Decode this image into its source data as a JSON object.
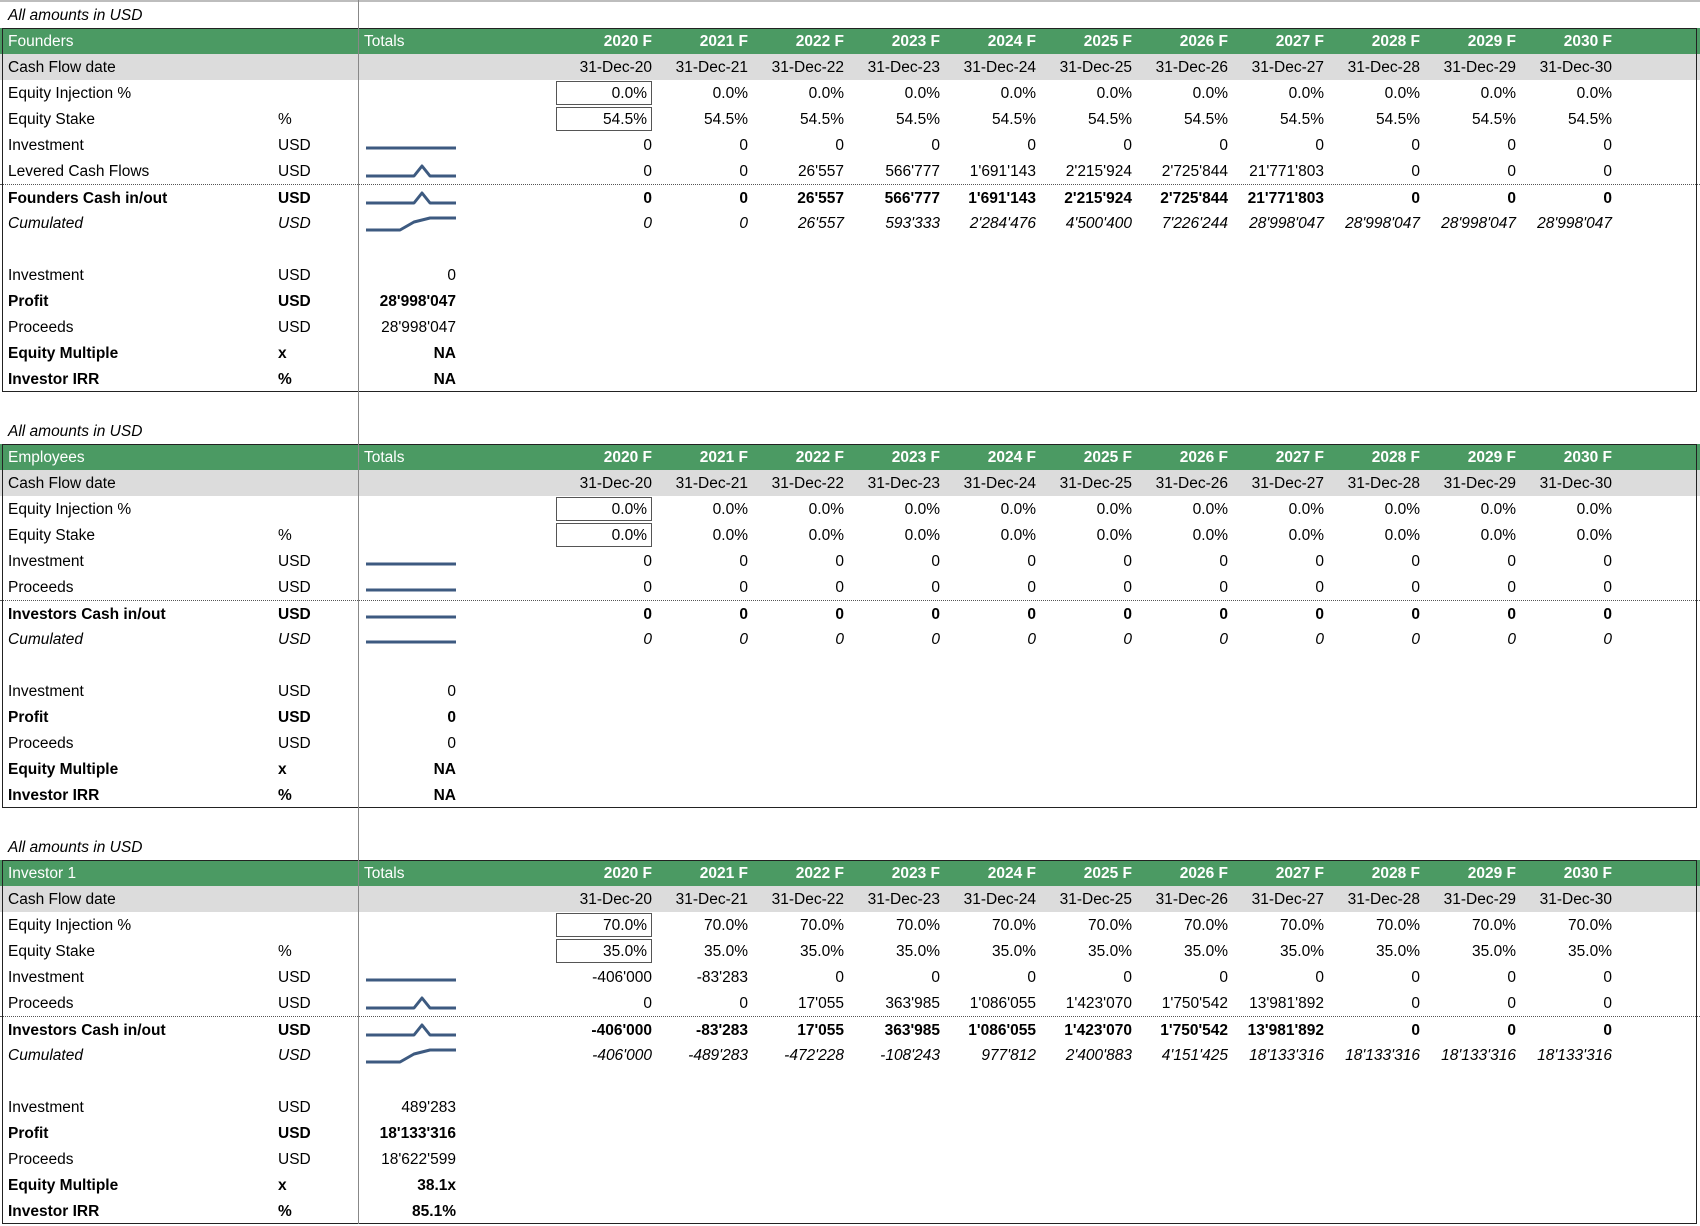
{
  "header_cols": [
    "2020 F",
    "2021 F",
    "2022 F",
    "2023 F",
    "2024 F",
    "2025 F",
    "2026 F",
    "2027 F",
    "2028 F",
    "2029 F",
    "2030 F"
  ],
  "dates": [
    "31-Dec-20",
    "31-Dec-21",
    "31-Dec-22",
    "31-Dec-23",
    "31-Dec-24",
    "31-Dec-25",
    "31-Dec-26",
    "31-Dec-27",
    "31-Dec-28",
    "31-Dec-29",
    "31-Dec-30"
  ],
  "labels": {
    "all_amounts": "All amounts in USD",
    "totals": "Totals",
    "cash_flow_date": "Cash Flow date"
  },
  "sections": [
    {
      "title": "Founders",
      "rows": [
        {
          "label": "Equity Injection %",
          "unit": "",
          "style": "plain",
          "boxed": true,
          "values": [
            "0.0%",
            "0.0%",
            "0.0%",
            "0.0%",
            "0.0%",
            "0.0%",
            "0.0%",
            "0.0%",
            "0.0%",
            "0.0%",
            "0.0%"
          ]
        },
        {
          "label": "Equity Stake",
          "unit": "%",
          "style": "plain",
          "boxed": true,
          "values": [
            "54.5%",
            "54.5%",
            "54.5%",
            "54.5%",
            "54.5%",
            "54.5%",
            "54.5%",
            "54.5%",
            "54.5%",
            "54.5%",
            "54.5%"
          ]
        },
        {
          "label": "Investment",
          "unit": "USD",
          "style": "plain",
          "spark": "flat",
          "values": [
            "0",
            "0",
            "0",
            "0",
            "0",
            "0",
            "0",
            "0",
            "0",
            "0",
            "0"
          ]
        },
        {
          "label": "Levered Cash Flows",
          "unit": "USD",
          "style": "plain",
          "spark": "peak",
          "values": [
            "0",
            "0",
            "26'557",
            "566'777",
            "1'691'143",
            "2'215'924",
            "2'725'844",
            "21'771'803",
            "0",
            "0",
            "0"
          ]
        },
        {
          "label": "Founders Cash in/out",
          "unit": "USD",
          "style": "bold",
          "sep": true,
          "spark": "peak",
          "values": [
            "0",
            "0",
            "26'557",
            "566'777",
            "1'691'143",
            "2'215'924",
            "2'725'844",
            "21'771'803",
            "0",
            "0",
            "0"
          ]
        },
        {
          "label": "Cumulated",
          "unit": "USD",
          "style": "italic",
          "spark": "step",
          "values": [
            "0",
            "0",
            "26'557",
            "593'333",
            "2'284'476",
            "4'500'400",
            "7'226'244",
            "28'998'047",
            "28'998'047",
            "28'998'047",
            "28'998'047"
          ]
        }
      ],
      "summary": [
        {
          "label": "Investment",
          "unit": "USD",
          "value": "0",
          "bold": false
        },
        {
          "label": "Profit",
          "unit": "USD",
          "value": "28'998'047",
          "bold": true
        },
        {
          "label": "Proceeds",
          "unit": "USD",
          "value": "28'998'047",
          "bold": false
        },
        {
          "label": "Equity Multiple",
          "unit": "x",
          "value": "NA",
          "bold": true
        },
        {
          "label": "Investor IRR",
          "unit": "%",
          "value": "NA",
          "bold": true
        }
      ]
    },
    {
      "title": "Employees",
      "rows": [
        {
          "label": "Equity Injection %",
          "unit": "",
          "style": "plain",
          "boxed": true,
          "values": [
            "0.0%",
            "0.0%",
            "0.0%",
            "0.0%",
            "0.0%",
            "0.0%",
            "0.0%",
            "0.0%",
            "0.0%",
            "0.0%",
            "0.0%"
          ]
        },
        {
          "label": "Equity Stake",
          "unit": "%",
          "style": "plain",
          "boxed": true,
          "values": [
            "0.0%",
            "0.0%",
            "0.0%",
            "0.0%",
            "0.0%",
            "0.0%",
            "0.0%",
            "0.0%",
            "0.0%",
            "0.0%",
            "0.0%"
          ]
        },
        {
          "label": "Investment",
          "unit": "USD",
          "style": "plain",
          "spark": "flat",
          "values": [
            "0",
            "0",
            "0",
            "0",
            "0",
            "0",
            "0",
            "0",
            "0",
            "0",
            "0"
          ]
        },
        {
          "label": "Proceeds",
          "unit": "USD",
          "style": "plain",
          "spark": "flat",
          "values": [
            "0",
            "0",
            "0",
            "0",
            "0",
            "0",
            "0",
            "0",
            "0",
            "0",
            "0"
          ]
        },
        {
          "label": "Investors Cash in/out",
          "unit": "USD",
          "style": "bold",
          "sep": true,
          "spark": "flat",
          "values": [
            "0",
            "0",
            "0",
            "0",
            "0",
            "0",
            "0",
            "0",
            "0",
            "0",
            "0"
          ]
        },
        {
          "label": "Cumulated",
          "unit": "USD",
          "style": "italic",
          "spark": "flat",
          "values": [
            "0",
            "0",
            "0",
            "0",
            "0",
            "0",
            "0",
            "0",
            "0",
            "0",
            "0"
          ]
        }
      ],
      "summary": [
        {
          "label": "Investment",
          "unit": "USD",
          "value": "0",
          "bold": false
        },
        {
          "label": "Profit",
          "unit": "USD",
          "value": "0",
          "bold": true
        },
        {
          "label": "Proceeds",
          "unit": "USD",
          "value": "0",
          "bold": false
        },
        {
          "label": "Equity Multiple",
          "unit": "x",
          "value": "NA",
          "bold": true
        },
        {
          "label": "Investor IRR",
          "unit": "%",
          "value": "NA",
          "bold": true
        }
      ]
    },
    {
      "title": "Investor 1",
      "rows": [
        {
          "label": "Equity Injection %",
          "unit": "",
          "style": "plain",
          "boxed": true,
          "values": [
            "70.0%",
            "70.0%",
            "70.0%",
            "70.0%",
            "70.0%",
            "70.0%",
            "70.0%",
            "70.0%",
            "70.0%",
            "70.0%",
            "70.0%"
          ]
        },
        {
          "label": "Equity Stake",
          "unit": "%",
          "style": "plain",
          "boxed": true,
          "values": [
            "35.0%",
            "35.0%",
            "35.0%",
            "35.0%",
            "35.0%",
            "35.0%",
            "35.0%",
            "35.0%",
            "35.0%",
            "35.0%",
            "35.0%"
          ]
        },
        {
          "label": "Investment",
          "unit": "USD",
          "style": "plain",
          "spark": "flat",
          "values": [
            "-406'000",
            "-83'283",
            "0",
            "0",
            "0",
            "0",
            "0",
            "0",
            "0",
            "0",
            "0"
          ]
        },
        {
          "label": "Proceeds",
          "unit": "USD",
          "style": "plain",
          "spark": "peak",
          "values": [
            "0",
            "0",
            "17'055",
            "363'985",
            "1'086'055",
            "1'423'070",
            "1'750'542",
            "13'981'892",
            "0",
            "0",
            "0"
          ]
        },
        {
          "label": "Investors Cash in/out",
          "unit": "USD",
          "style": "bold",
          "sep": true,
          "spark": "peak",
          "values": [
            "-406'000",
            "-83'283",
            "17'055",
            "363'985",
            "1'086'055",
            "1'423'070",
            "1'750'542",
            "13'981'892",
            "0",
            "0",
            "0"
          ]
        },
        {
          "label": "Cumulated",
          "unit": "USD",
          "style": "italic",
          "spark": "step",
          "values": [
            "-406'000",
            "-489'283",
            "-472'228",
            "-108'243",
            "977'812",
            "2'400'883",
            "4'151'425",
            "18'133'316",
            "18'133'316",
            "18'133'316",
            "18'133'316"
          ]
        }
      ],
      "summary": [
        {
          "label": "Investment",
          "unit": "USD",
          "value": "489'283",
          "bold": false
        },
        {
          "label": "Profit",
          "unit": "USD",
          "value": "18'133'316",
          "bold": true
        },
        {
          "label": "Proceeds",
          "unit": "USD",
          "value": "18'622'599",
          "bold": false
        },
        {
          "label": "Equity Multiple",
          "unit": "x",
          "value": "38.1x",
          "bold": true
        },
        {
          "label": "Investor IRR",
          "unit": "%",
          "value": "85.1%",
          "bold": true
        }
      ]
    }
  ],
  "colors": {
    "header_green": "#4b9a63",
    "date_grey": "#dcdcdc",
    "sparkline": "#3d5a80"
  }
}
